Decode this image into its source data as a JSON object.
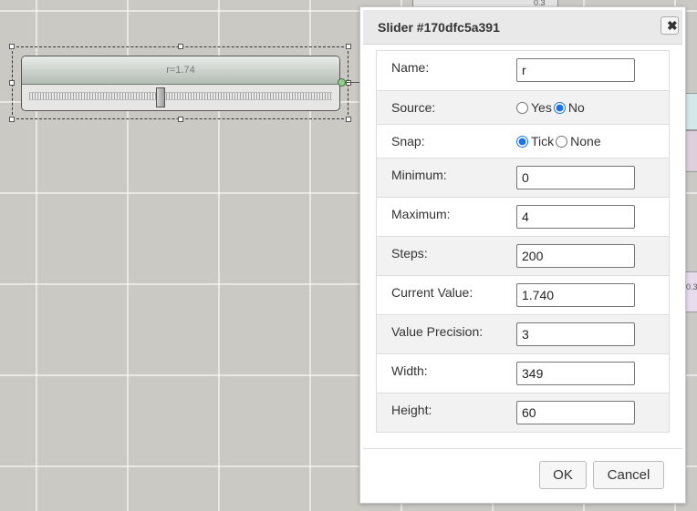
{
  "canvas": {
    "slider_label": "r=1.74",
    "slider_value": 1.74,
    "slider_min": 0,
    "slider_max": 4,
    "bg_top_label": "0.3",
    "bg_right_label": "0.3"
  },
  "dialog": {
    "title": "Slider #170dfc5a391",
    "close_symbol": "✖",
    "fields": {
      "name": {
        "label": "Name:",
        "value": "r"
      },
      "source": {
        "label": "Source:",
        "yes": "Yes",
        "no": "No",
        "selected": "No"
      },
      "snap": {
        "label": "Snap:",
        "tick": "Tick",
        "none": "None",
        "selected": "Tick"
      },
      "minimum": {
        "label": "Minimum:",
        "value": "0"
      },
      "maximum": {
        "label": "Maximum:",
        "value": "4"
      },
      "steps": {
        "label": "Steps:",
        "value": "200"
      },
      "current_value": {
        "label": "Current Value:",
        "value": "1.740"
      },
      "value_precision": {
        "label": "Value Precision:",
        "value": "3"
      },
      "width": {
        "label": "Width:",
        "value": "349"
      },
      "height": {
        "label": "Height:",
        "value": "60"
      }
    },
    "ok_label": "OK",
    "cancel_label": "Cancel"
  },
  "icons": {
    "close": "close-icon",
    "output_port": "output-port-icon"
  },
  "colors": {
    "accent": "#1a73e8",
    "canvas_bg": "#cbc9c4",
    "port_green": "#8fd08a"
  }
}
